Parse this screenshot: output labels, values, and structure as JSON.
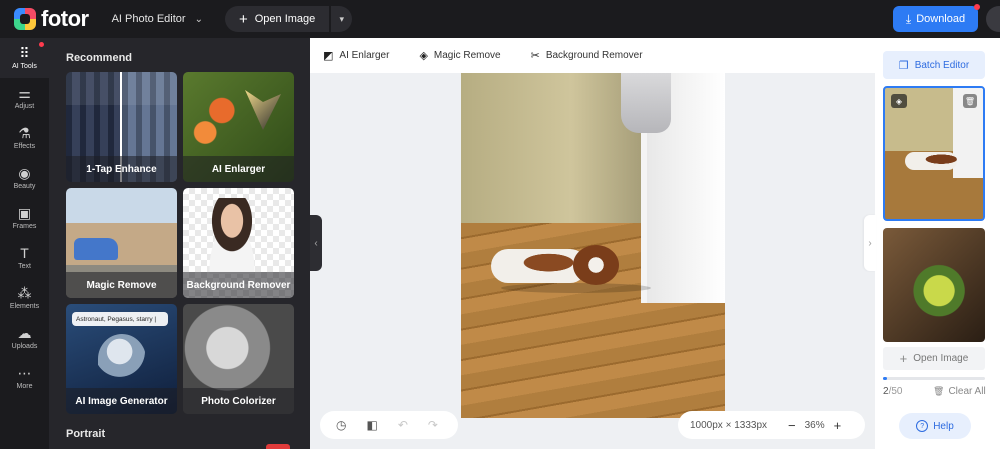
{
  "topbar": {
    "logo_text": "fotor",
    "tool_switch_label": "AI Photo Editor",
    "open_image_label": "Open Image",
    "download_label": "Download",
    "accent": "#2d7bf4"
  },
  "rail": {
    "items": [
      {
        "label": "AI Tools",
        "icon": "grid-icon"
      },
      {
        "label": "Adjust",
        "icon": "sliders-icon"
      },
      {
        "label": "Effects",
        "icon": "flask-icon"
      },
      {
        "label": "Beauty",
        "icon": "eye-icon"
      },
      {
        "label": "Frames",
        "icon": "frame-icon"
      },
      {
        "label": "Text",
        "icon": "text-icon"
      },
      {
        "label": "Elements",
        "icon": "shapes-icon"
      },
      {
        "label": "Uploads",
        "icon": "upload-icon"
      },
      {
        "label": "More",
        "icon": "more-icon"
      }
    ]
  },
  "panel": {
    "section_recommend": "Recommend",
    "section_portrait": "Portrait",
    "cards": [
      {
        "label": "1-Tap Enhance"
      },
      {
        "label": "AI Enlarger"
      },
      {
        "label": "Magic Remove"
      },
      {
        "label": "Background Remover"
      },
      {
        "label": "AI Image Generator",
        "prompt": "Astronaut, Pegasus, starry |"
      },
      {
        "label": "Photo Colorizer"
      }
    ]
  },
  "subtoolbar": {
    "items": [
      {
        "label": "AI Enlarger",
        "icon": "enlarge-icon"
      },
      {
        "label": "Magic Remove",
        "icon": "eraser-icon"
      },
      {
        "label": "Background Remover",
        "icon": "scissors-icon"
      }
    ]
  },
  "canvas": {
    "dimensions": "1000px × 1333px",
    "zoom": "36%"
  },
  "right_panel": {
    "batch_editor_label": "Batch Editor",
    "open_image_label": "Open Image",
    "count_current": "2",
    "count_total": "/50",
    "progress": 0.04,
    "clear_all_label": "Clear All",
    "help_label": "Help"
  }
}
